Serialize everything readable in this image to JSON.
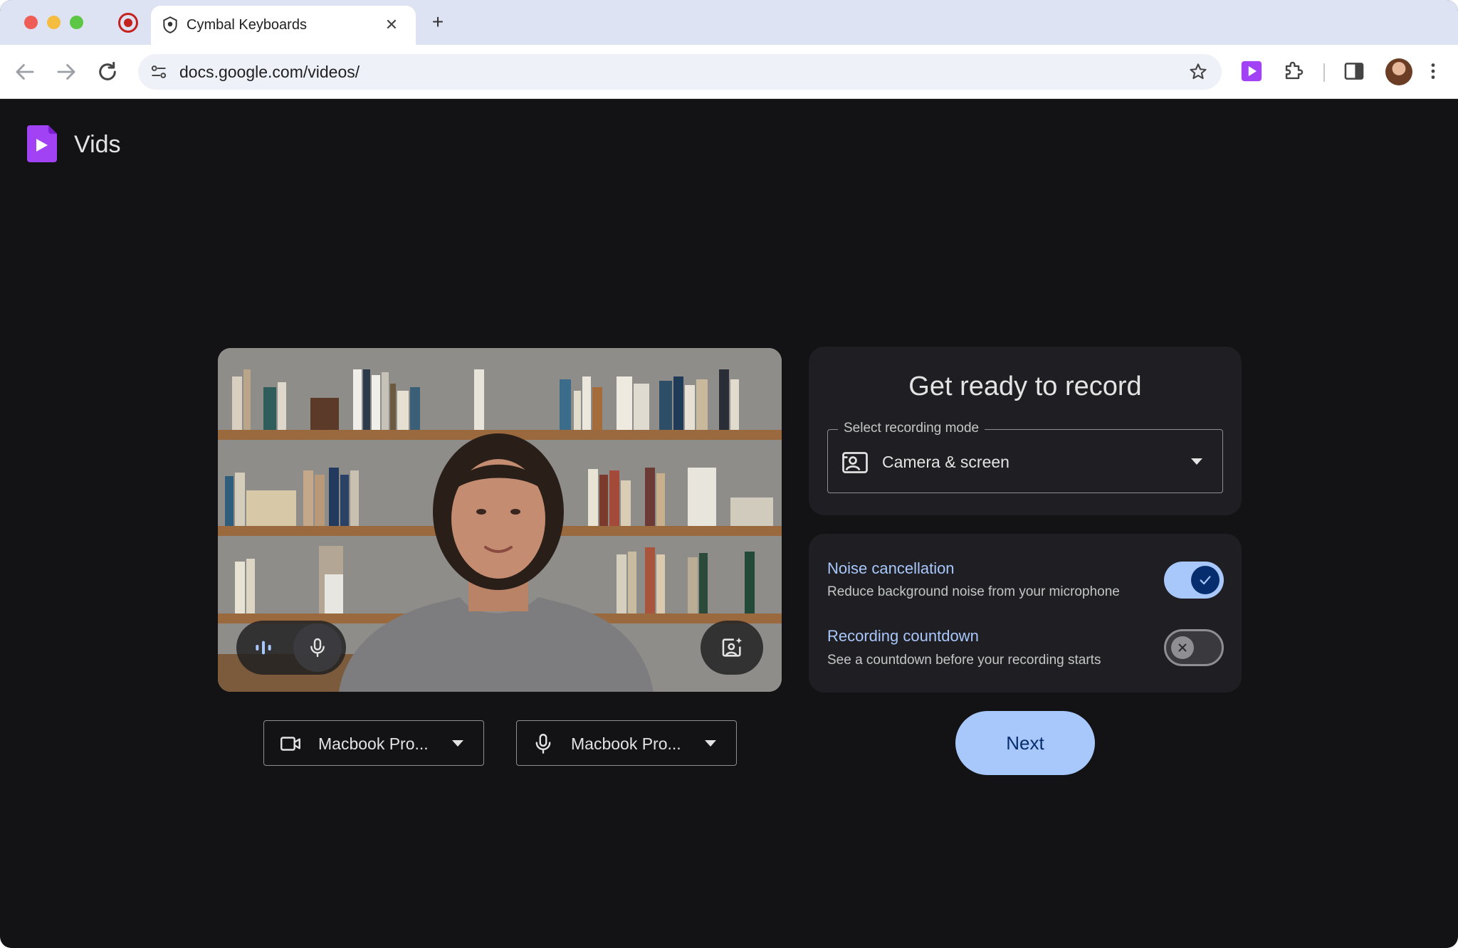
{
  "browser": {
    "tab_title": "Cymbal Keyboards",
    "tab_close_glyph": "✕",
    "new_tab_glyph": "+",
    "url": "docs.google.com/videos/",
    "icons": [
      "back-arrow-icon",
      "forward-arrow-icon",
      "reload-icon",
      "site-settings-icon",
      "bookmark-star-icon",
      "vids-extension-icon",
      "extensions-puzzle-icon",
      "side-panel-icon",
      "profile-avatar",
      "more-vert-icon"
    ]
  },
  "app": {
    "name": "Vids",
    "brand_color": "#a142f4"
  },
  "preview": {
    "left_controls": [
      "audio-level-icon",
      "microphone-icon"
    ],
    "right_control": "background-effects-icon"
  },
  "devices": {
    "camera_label": "Macbook Pro...",
    "microphone_label": "Macbook Pro..."
  },
  "ready": {
    "title": "Get ready to record",
    "mode_legend": "Select recording mode",
    "mode_value": "Camera & screen"
  },
  "settings": {
    "noise": {
      "title": "Noise cancellation",
      "description": "Reduce background noise from your microphone",
      "enabled": true
    },
    "countdown": {
      "title": "Recording countdown",
      "description": "See a countdown before your recording starts",
      "enabled": false
    }
  },
  "next_label": "Next",
  "colors": {
    "accent": "#a8c7fa",
    "accent_text": "#062e6f",
    "page_bg": "#131316",
    "card_bg": "#1f1f23"
  }
}
